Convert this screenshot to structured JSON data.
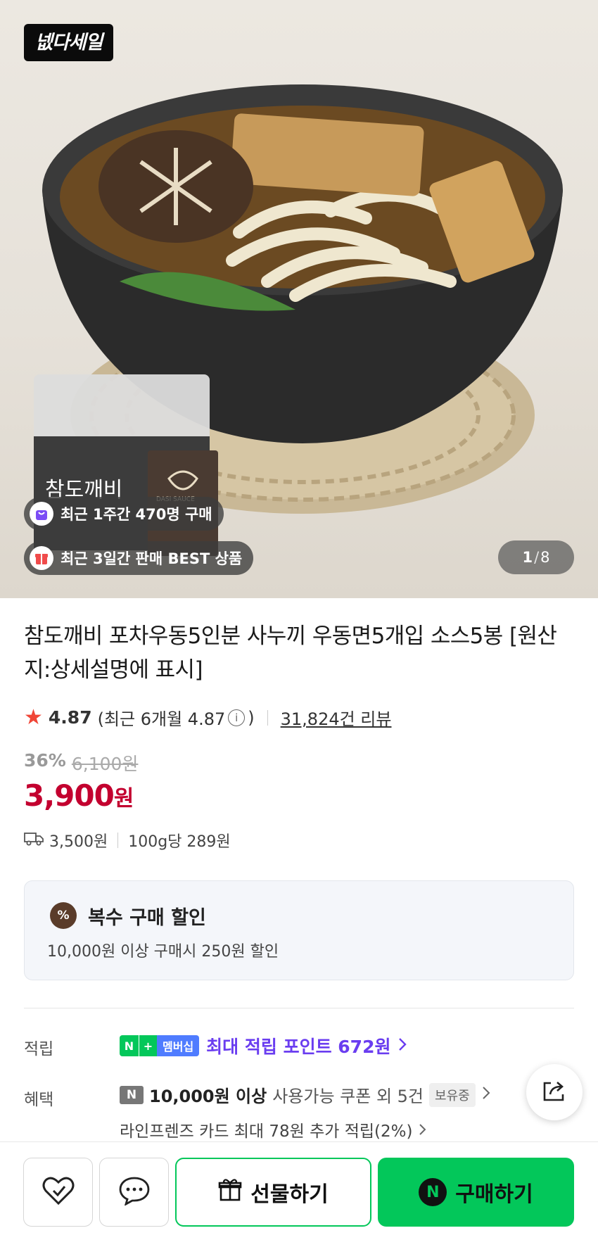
{
  "hero": {
    "badge": "넶다세일",
    "pill_recent_buy": "최근 1주간 470명 구매",
    "pill_best": "최근 3일간 판매 BEST 상품",
    "counter_current": "1",
    "counter_total": "8",
    "package_brand": "참도깨비",
    "sauce_label": "DASI SAUCE"
  },
  "product": {
    "title": "참도깨비 포차우동5인분 사누끼 우동면5개입 소스5봉 [원산지:상세설명에 표시]",
    "rating_score": "4.87",
    "rating_recent_prefix": "(최근 6개월 4.87",
    "rating_recent_suffix": ")",
    "review_count": "31,824건 리뷰",
    "discount_pct": "36%",
    "original_price": "6,100원",
    "sale_price": "3,900",
    "sale_unit": "원",
    "shipping_fee": "3,500원",
    "unit_price": "100g당 289원"
  },
  "bundle": {
    "badge": "%",
    "title": "복수 구매 할인",
    "desc": "10,000원 이상 구매시 250원 할인"
  },
  "rows": {
    "point_label": "적립",
    "benefit_label": "혜택",
    "nplus_n": "N",
    "nplus_plus": "+",
    "nplus_membership": "멤버십",
    "point_text": "최대 적립 포인트 672원",
    "coupon_icon": "N",
    "coupon_bold": "10,000원 이상",
    "coupon_rest": "사용가능 쿠폰 외 5건",
    "coupon_hold": "보유중",
    "card_text": "라인프렌즈 카드 최대 78원 추가 적립(2%)"
  },
  "bottom": {
    "gift_label": "선물하기",
    "buy_label": "구매하기",
    "buy_icon": "N"
  },
  "colors": {
    "naver_green": "#03c75a",
    "price_red": "#c3002f",
    "point_purple": "#6a3df0"
  }
}
